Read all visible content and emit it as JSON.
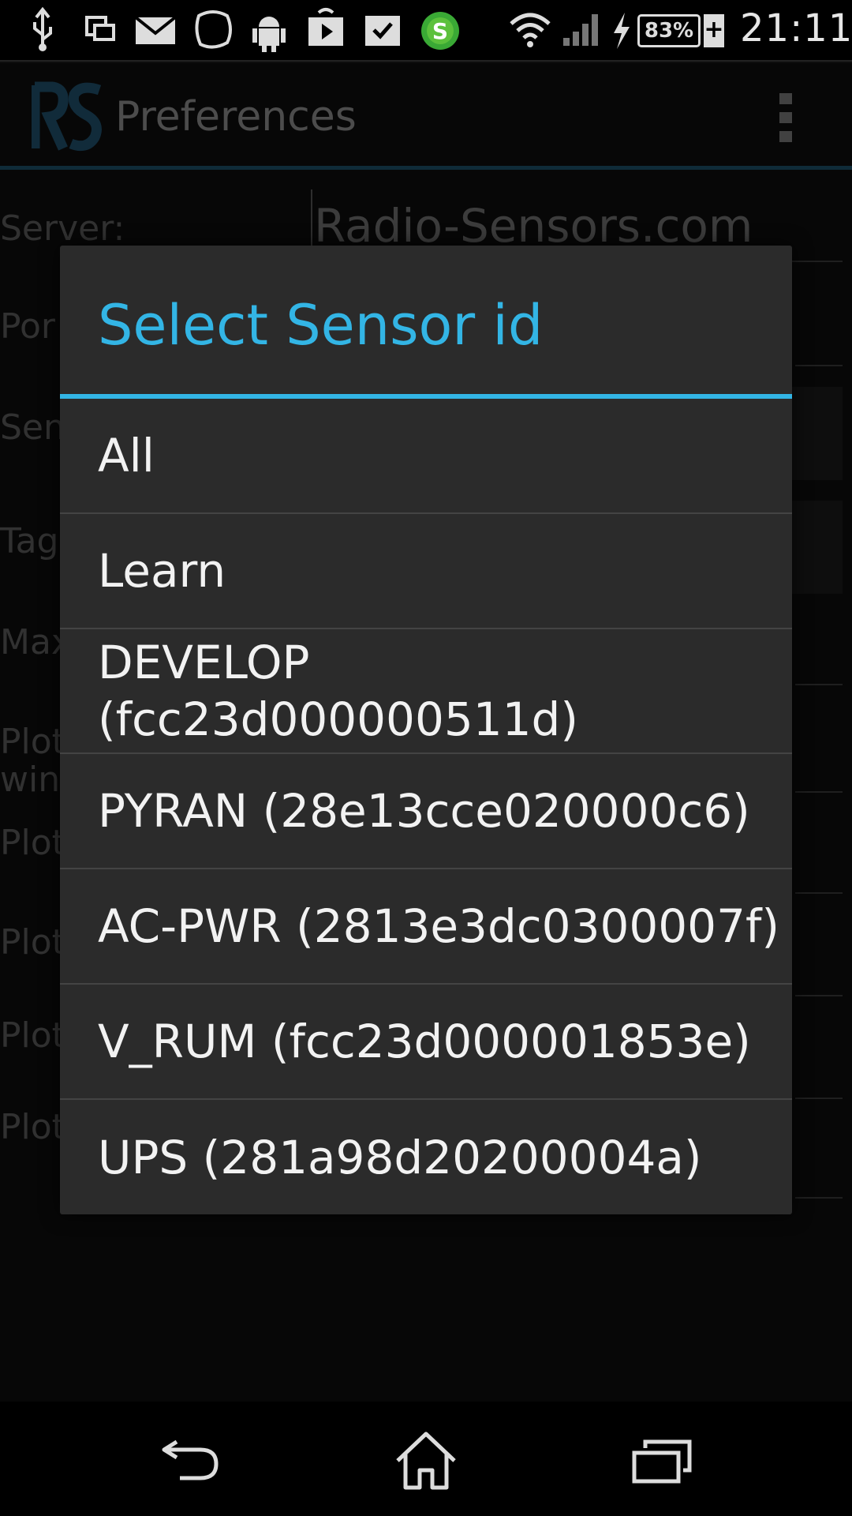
{
  "status_bar": {
    "battery_percent": "83%",
    "battery_plus": "+",
    "time": "21:11",
    "icons": [
      "usb-icon",
      "screen-mirror-icon",
      "mail-icon",
      "chat-bubble-icon",
      "android-icon",
      "play-store-icon",
      "clipboard-check-icon",
      "app-s-icon",
      "wifi-icon",
      "cell-signal-icon",
      "charging-icon",
      "battery-icon"
    ]
  },
  "action_bar": {
    "logo_icon": "rs-logo-icon",
    "title": "Preferences",
    "overflow_icon": "overflow-menu-icon"
  },
  "preferences": {
    "server_label": "Server:",
    "server_value": "Radio-Sensors.com",
    "rows": [
      {
        "label": "Por"
      },
      {
        "label": "Sen"
      },
      {
        "label": "Tag"
      },
      {
        "label": "Max"
      },
      {
        "label": "Plot win"
      },
      {
        "label": "Plot"
      },
      {
        "label": "Plot"
      },
      {
        "label": "Plot"
      },
      {
        "label": "Plot"
      }
    ]
  },
  "dialog": {
    "title": "Select Sensor id",
    "options": [
      {
        "label": "All"
      },
      {
        "label": "Learn"
      },
      {
        "label": "DEVELOP (fcc23d000000511d)"
      },
      {
        "label": "PYRAN (28e13cce020000c6)"
      },
      {
        "label": "AC-PWR (2813e3dc0300007f)"
      },
      {
        "label": "V_RUM (fcc23d000001853e)"
      },
      {
        "label": "UPS (281a98d20200004a)"
      }
    ]
  },
  "nav_bar": {
    "icons": [
      "back-icon",
      "home-icon",
      "recent-apps-icon"
    ]
  },
  "colors": {
    "accent": "#33b5e5",
    "dialog_bg": "#2b2b2b",
    "actionbar_rule": "#1d4f66"
  }
}
